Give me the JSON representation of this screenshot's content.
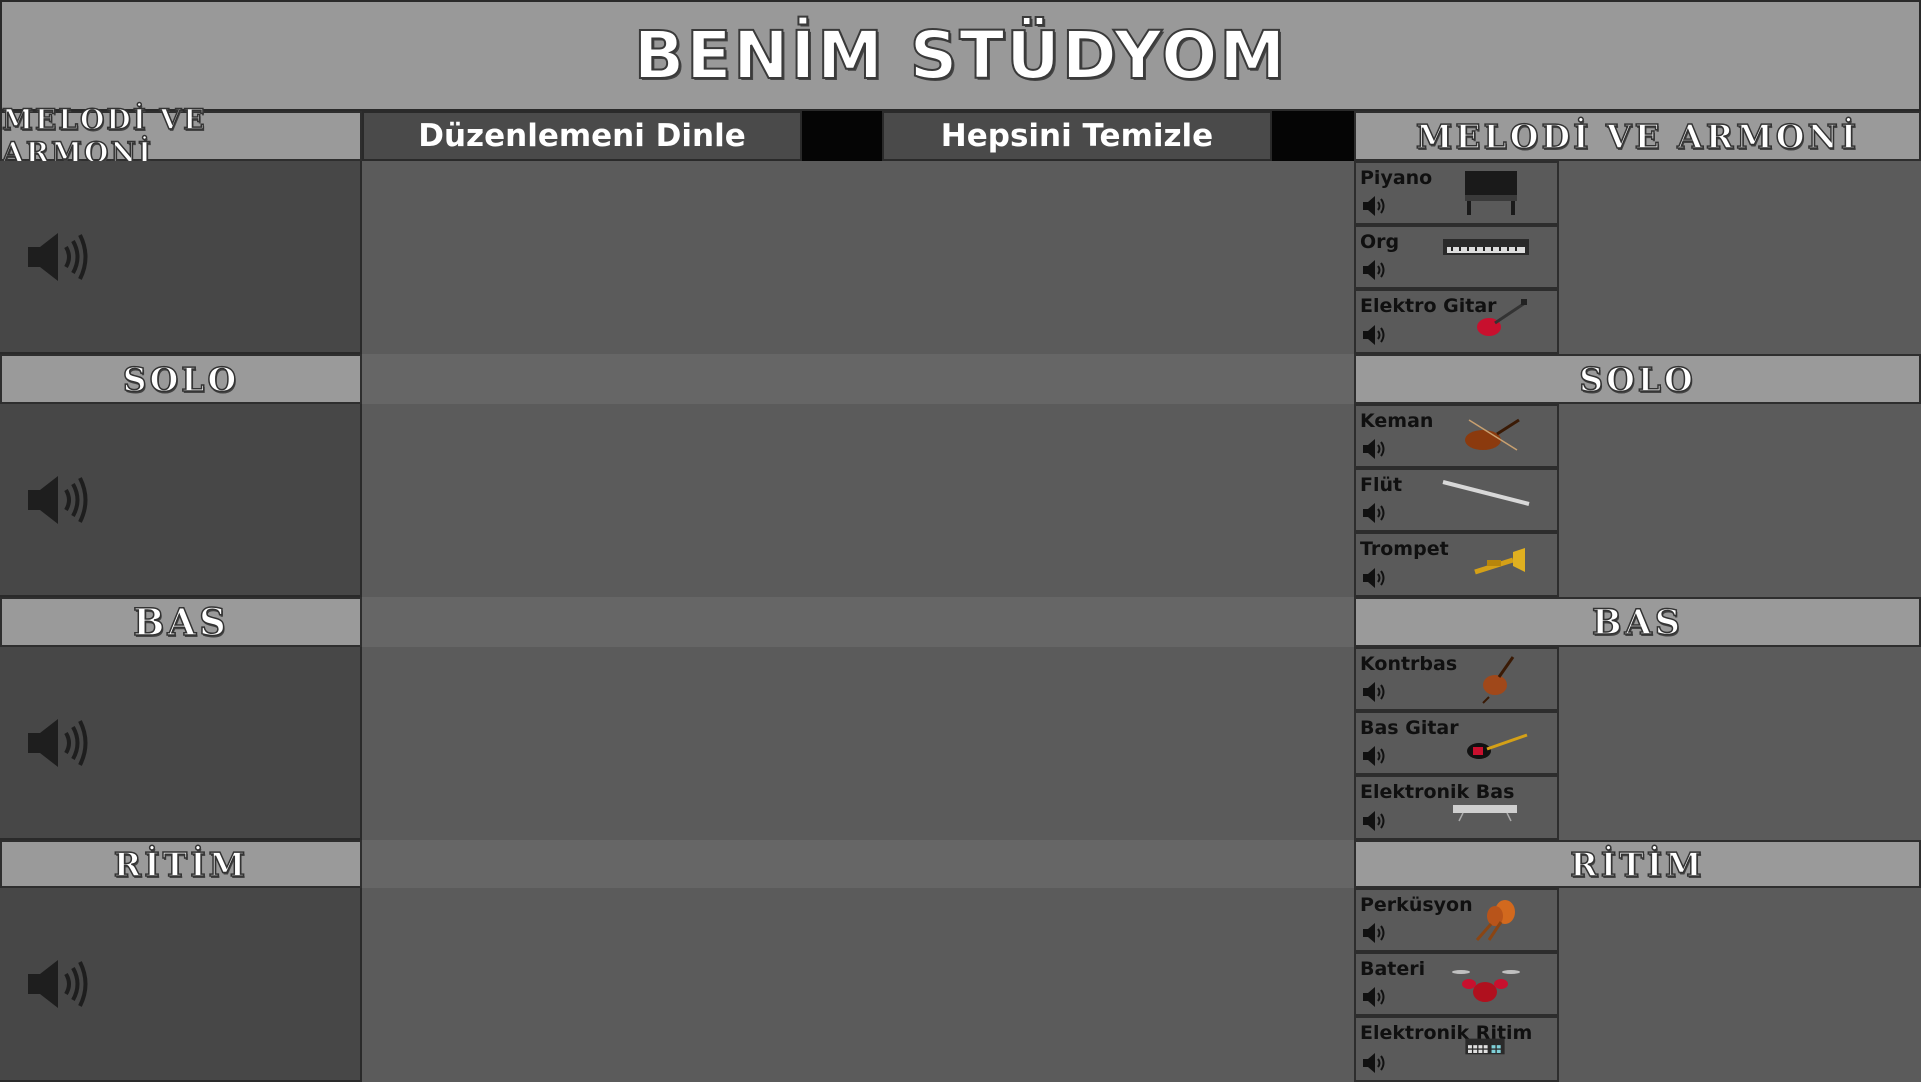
{
  "app": {
    "title": "BENİM STÜDYOM"
  },
  "toolbar": {
    "listen_label": "Düzenlemeni Dinle",
    "clear_label": "Hepsini Temizle"
  },
  "left_headers": {
    "melody": "MELODİ VE ARMONİ",
    "solo": "SOLO",
    "bass": "BAS",
    "rhythm": "RİTİM"
  },
  "right_headers": {
    "melody": "MELODİ VE ARMONİ",
    "solo": "SOLO",
    "bass": "BAS",
    "rhythm": "RİTİM"
  },
  "instruments": {
    "melody": [
      {
        "name": "Piyano",
        "icon": "piano-icon"
      },
      {
        "name": "Org",
        "icon": "keyboard-icon"
      },
      {
        "name": "Elektro Gitar",
        "icon": "electric-guitar-icon"
      }
    ],
    "solo": [
      {
        "name": "Keman",
        "icon": "violin-icon"
      },
      {
        "name": "Flüt",
        "icon": "flute-icon"
      },
      {
        "name": "Trompet",
        "icon": "trumpet-icon"
      }
    ],
    "bass": [
      {
        "name": "Kontrbas",
        "icon": "double-bass-icon"
      },
      {
        "name": "Bas Gitar",
        "icon": "bass-guitar-icon"
      },
      {
        "name": "Elektronik Bas",
        "icon": "synth-icon"
      }
    ],
    "rhythm": [
      {
        "name": "Perküsyon",
        "icon": "maracas-icon"
      },
      {
        "name": "Bateri",
        "icon": "drum-kit-icon"
      },
      {
        "name": "Elektronik Ritim",
        "icon": "drum-machine-icon"
      }
    ]
  },
  "colors": {
    "background": "#5b5b5b",
    "header": "#9a9a9a",
    "panel": "#474747",
    "button": "#4a4a4a"
  }
}
